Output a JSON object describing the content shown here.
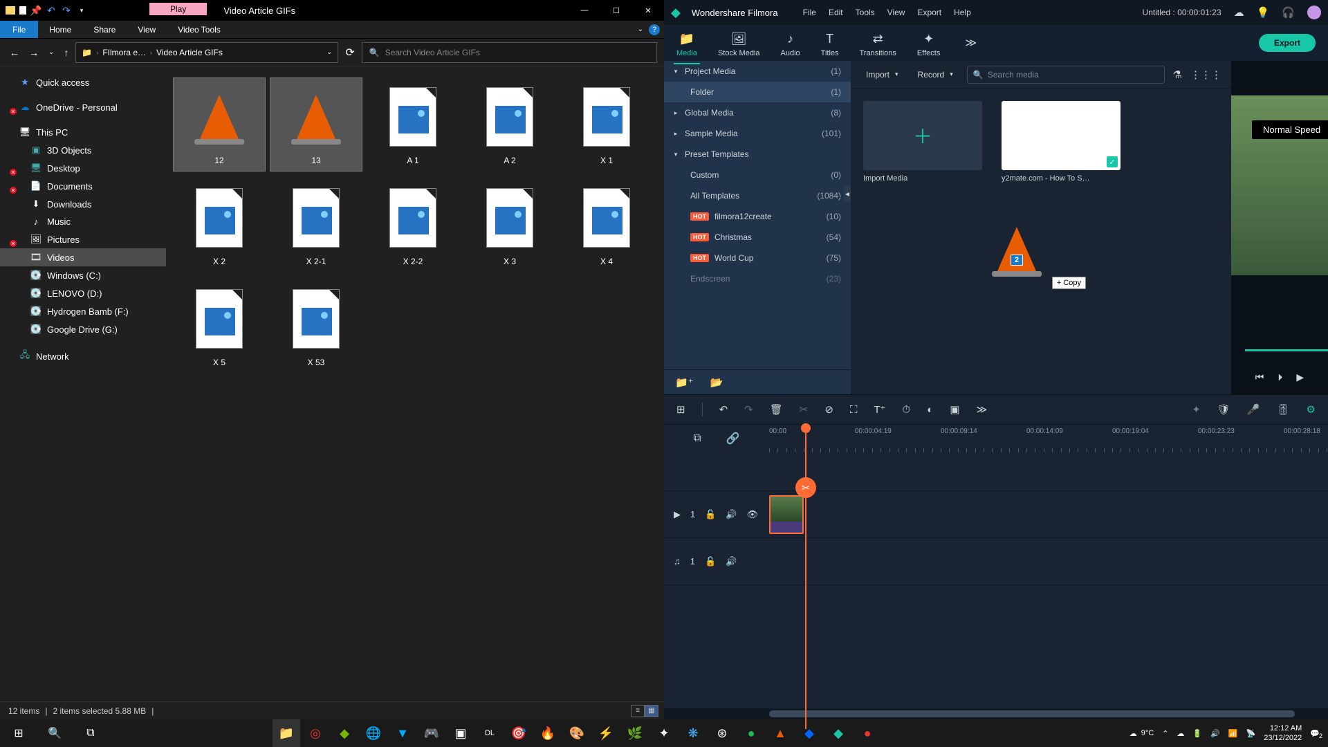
{
  "explorer": {
    "play_tab": "Play",
    "window_title": "Video Article GIFs",
    "ribbon": {
      "file": "File",
      "tabs": [
        "Home",
        "Share",
        "View",
        "Video Tools"
      ]
    },
    "breadcrumb": {
      "path1": "FIlmora e…",
      "path2": "Video Article GIFs"
    },
    "search_placeholder": "Search Video Article GIFs",
    "sidebar": {
      "quick": "Quick access",
      "onedrive": "OneDrive - Personal",
      "thispc": "This PC",
      "items": [
        "3D Objects",
        "Desktop",
        "Documents",
        "Downloads",
        "Music",
        "Pictures",
        "Videos",
        "Windows (C:)",
        "LENOVO (D:)",
        "Hydrogen Bamb (F:)",
        "Google Drive (G:)"
      ],
      "network": "Network"
    },
    "files": [
      {
        "name": "12",
        "type": "vlc",
        "sel": true
      },
      {
        "name": "13",
        "type": "vlc",
        "sel": true
      },
      {
        "name": "A 1",
        "type": "img"
      },
      {
        "name": "A 2",
        "type": "img"
      },
      {
        "name": "X 1",
        "type": "img"
      },
      {
        "name": "X 2",
        "type": "img"
      },
      {
        "name": "X 2-1",
        "type": "img"
      },
      {
        "name": "X 2-2",
        "type": "img"
      },
      {
        "name": "X 3",
        "type": "img"
      },
      {
        "name": "X 4",
        "type": "img"
      },
      {
        "name": "X 5",
        "type": "img"
      },
      {
        "name": "X 53",
        "type": "img"
      }
    ],
    "status": {
      "count": "12 items",
      "sel": "2 items selected  5.88 MB"
    }
  },
  "filmora": {
    "app_name": "Wondershare Filmora",
    "menu": [
      "File",
      "Edit",
      "Tools",
      "View",
      "Export",
      "Help"
    ],
    "project_title": "Untitled : 00:00:01:23",
    "tabs": [
      {
        "label": "Media",
        "ico": "📁",
        "active": true
      },
      {
        "label": "Stock Media",
        "ico": "🖼"
      },
      {
        "label": "Audio",
        "ico": "♪"
      },
      {
        "label": "Titles",
        "ico": "T"
      },
      {
        "label": "Transitions",
        "ico": "⇄"
      },
      {
        "label": "Effects",
        "ico": "✦"
      }
    ],
    "export": "Export",
    "project_media": {
      "rows": [
        {
          "label": "Project Media",
          "count": "(1)",
          "arrow": "▾"
        },
        {
          "label": "Folder",
          "count": "(1)",
          "sel": true,
          "indent": true
        },
        {
          "label": "Global Media",
          "count": "(8)",
          "arrow": "▸"
        },
        {
          "label": "Sample Media",
          "count": "(101)",
          "arrow": "▸"
        },
        {
          "label": "Preset Templates",
          "count": "",
          "arrow": "▾"
        },
        {
          "label": "Custom",
          "count": "(0)",
          "indent": true
        },
        {
          "label": "All Templates",
          "count": "(1084)",
          "indent": true
        },
        {
          "label": "filmora12create",
          "count": "(10)",
          "hot": true,
          "indent": true
        },
        {
          "label": "Christmas",
          "count": "(54)",
          "hot": true,
          "indent": true
        },
        {
          "label": "World Cup",
          "count": "(75)",
          "hot": true,
          "indent": true
        },
        {
          "label": "Endscreen",
          "count": "(23)",
          "indent": true,
          "fade": true
        }
      ]
    },
    "content_bar": {
      "import": "Import",
      "record": "Record",
      "search": "Search media"
    },
    "media_items": {
      "import_label": "Import Media",
      "video_label": "y2mate.com - How To S…"
    },
    "drag": {
      "count": "2",
      "copy": "+ Copy"
    },
    "preview": {
      "speed": "Normal Speed"
    },
    "ruler": [
      "00:00",
      "00:00:04:19",
      "00:00:09:14",
      "00:00:14:09",
      "00:00:19:04",
      "00:00:23:23",
      "00:00:28:18"
    ],
    "tracks": {
      "video": "1",
      "audio": "1"
    }
  },
  "taskbar": {
    "weather": "9°C",
    "time": "12:12 AM",
    "date": "23/12/2022",
    "notif": "2"
  }
}
